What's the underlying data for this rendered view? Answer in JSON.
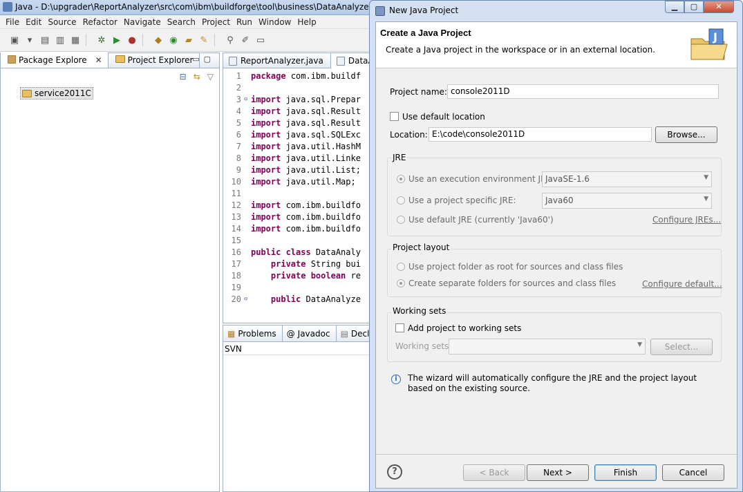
{
  "ide": {
    "title": "Java - D:\\upgrader\\ReportAnalyzer\\src\\com\\ibm\\buildforge\\tool\\business\\DataAnalyzer.java - Ec",
    "menu": [
      "File",
      "Edit",
      "Source",
      "Refactor",
      "Navigate",
      "Search",
      "Project",
      "Run",
      "Window",
      "Help"
    ],
    "left_tabs": {
      "package_explorer": "Package Explore",
      "project_explorer": "Project Explorer"
    },
    "tree_item": "service2011C",
    "editor_tabs": {
      "tab1": "ReportAnalyzer.java",
      "tab2": "DataAn"
    },
    "code": [
      {
        "n": "1",
        "kw": "package",
        "rest": " com.ibm.buildf"
      },
      {
        "n": "2",
        "kw": "",
        "rest": ""
      },
      {
        "n": "3",
        "kw": "import",
        "rest": " java.sql.Prepar",
        "mark": "⊖"
      },
      {
        "n": "4",
        "kw": "import",
        "rest": " java.sql.Result"
      },
      {
        "n": "5",
        "kw": "import",
        "rest": " java.sql.Result"
      },
      {
        "n": "6",
        "kw": "import",
        "rest": " java.sql.SQLExc"
      },
      {
        "n": "7",
        "kw": "import",
        "rest": " java.util.HashM"
      },
      {
        "n": "8",
        "kw": "import",
        "rest": " java.util.Linke"
      },
      {
        "n": "9",
        "kw": "import",
        "rest": " java.util.List;"
      },
      {
        "n": "10",
        "kw": "import",
        "rest": " java.util.Map;"
      },
      {
        "n": "11",
        "kw": "",
        "rest": ""
      },
      {
        "n": "12",
        "kw": "import",
        "rest": " com.ibm.buildfo"
      },
      {
        "n": "13",
        "kw": "import",
        "rest": " com.ibm.buildfo"
      },
      {
        "n": "14",
        "kw": "import",
        "rest": " com.ibm.buildfo"
      },
      {
        "n": "15",
        "kw": "",
        "rest": ""
      },
      {
        "n": "16",
        "kw": "public class",
        "rest": " DataAnaly"
      },
      {
        "n": "17",
        "kw": "    private",
        "rest": " String bui"
      },
      {
        "n": "18",
        "kw": "    private boolean",
        "rest": " re"
      },
      {
        "n": "19",
        "kw": "",
        "rest": ""
      },
      {
        "n": "20",
        "kw": "    public",
        "rest": " DataAnalyze",
        "mark": "⊖"
      }
    ],
    "bottom_tabs": {
      "problems": "Problems",
      "javadoc": "Javadoc",
      "declaration": "Declarat"
    },
    "bottom_header": "SVN"
  },
  "dialog": {
    "window_title": "New Java Project",
    "heading": "Create a Java Project",
    "description": "Create a Java project in the workspace or in an external location.",
    "project_name_label": "Project name:",
    "project_name_value": "console2011D",
    "use_default_location": "Use default location",
    "location_label": "Location:",
    "location_value": "E:\\code\\console2011D",
    "browse": "Browse...",
    "jre": {
      "group": "JRE",
      "exec_env": "Use an execution environment JRE:",
      "exec_env_value": "JavaSE-1.6",
      "project_specific": "Use a project specific JRE:",
      "project_specific_value": "Java60",
      "default_jre": "Use default JRE (currently 'Java60')",
      "configure": "Configure JREs..."
    },
    "layout": {
      "group": "Project layout",
      "root": "Use project folder as root for sources and class files",
      "separate": "Create separate folders for sources and class files",
      "configure": "Configure default..."
    },
    "working_sets": {
      "group": "Working sets",
      "add": "Add project to working sets",
      "label": "Working sets:",
      "select": "Select..."
    },
    "info": "The wizard will automatically configure the JRE and the project layout based on the existing source.",
    "buttons": {
      "back": "< Back",
      "next": "Next >",
      "finish": "Finish",
      "cancel": "Cancel"
    }
  }
}
